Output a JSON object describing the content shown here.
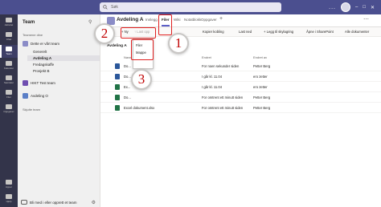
{
  "titlebar": {
    "search_placeholder": "Søk",
    "more": "...",
    "window_controls": [
      "–",
      "□",
      "✕"
    ]
  },
  "rail": [
    {
      "label": "Aktivitet",
      "icon": "bell-icon"
    },
    {
      "label": "Chat",
      "icon": "chat-icon"
    },
    {
      "label": "Team",
      "icon": "teams-icon",
      "active": true
    },
    {
      "label": "Kalender",
      "icon": "calendar-icon"
    },
    {
      "label": "Samtaler",
      "icon": "phone-icon"
    },
    {
      "label": "Filer",
      "icon": "file-icon"
    },
    {
      "label": "Oppgaver",
      "icon": "tasks-icon"
    },
    {
      "label": "Apper",
      "icon": "apps-icon"
    },
    {
      "label": "Hjelp",
      "icon": "help-icon"
    }
  ],
  "sidepanel": {
    "title": "Team",
    "your_teams_label": "Teamene dine",
    "teams": [
      {
        "name": "Dette er vårt team",
        "channels": [
          "Generelt",
          "Avdeling A",
          "Fredagskaffe",
          "Prosjekt B"
        ],
        "selected": "Avdeling A"
      },
      {
        "name": "HIKT Test team",
        "channels": []
      },
      {
        "name": "Avdeling O",
        "channels": []
      }
    ],
    "hidden_teams_label": "Skjulte team",
    "join_create": "Bli med i eller opprett et team"
  },
  "channel_header": {
    "title": "Avdeling A",
    "tabs": [
      "Innlegg",
      "Filer",
      "Wiki",
      "Notatblokk",
      "Oppgaver"
    ],
    "active_tab": "Filer",
    "add_tab": "+"
  },
  "toolbar": {
    "new_label": "+ Ny",
    "upload_label": "↑ Last opp",
    "copy_link_label": "Kopier kobling",
    "download_label": "Last ned",
    "add_cloud_label": "+ Legg til skylagring",
    "sharepoint_label": "Åpne i SharePoint",
    "all_docs_label": "Alle dokumenter"
  },
  "file_list": {
    "breadcrumb": "Avdeling A",
    "columns": {
      "name": "Navn",
      "modified": "Endret",
      "modified_by": "Endret av"
    },
    "rows": [
      {
        "name": "Do...",
        "modified": "For noen sekunder siden",
        "modified_by": "Petter Berg",
        "type": "word"
      },
      {
        "name": "Do...",
        "modified": "I går kl. 11.04",
        "modified_by": "ero zetter",
        "type": "word"
      },
      {
        "name": "Ex...",
        "modified": "I går kl. 11.04",
        "modified_by": "ero zetter",
        "type": "excel"
      },
      {
        "name": "Do...",
        "modified": "For omtrent ett minutt siden",
        "modified_by": "Petter Berg",
        "type": "excel"
      },
      {
        "name": "Excel dokument.xlsx",
        "modified": "For omtrent ett minutt siden",
        "modified_by": "Petter Berg",
        "type": "excel"
      }
    ]
  },
  "new_menu": {
    "items": [
      "Filer",
      "Mappe"
    ]
  },
  "callouts": [
    "1",
    "2",
    "3"
  ],
  "colors": {
    "titlebar": "#4b4f8f",
    "rail": "#33344a",
    "accent": "#5b5fc7",
    "callout_number": "#c00000",
    "highlight": "#e02020"
  }
}
